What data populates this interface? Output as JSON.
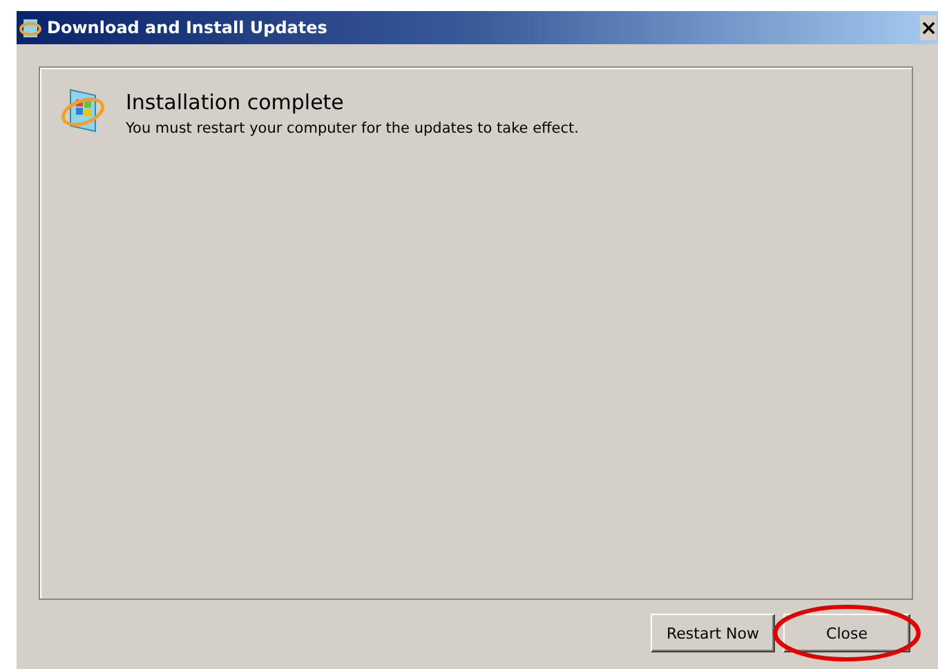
{
  "window": {
    "title": "Download and Install Updates",
    "close_glyph": "×"
  },
  "status": {
    "heading": "Installation complete",
    "message": "You must restart your computer for the updates to take effect."
  },
  "buttons": [
    {
      "label": "Restart Now",
      "highlighted": false
    },
    {
      "label": "Close",
      "highlighted": true
    }
  ]
}
